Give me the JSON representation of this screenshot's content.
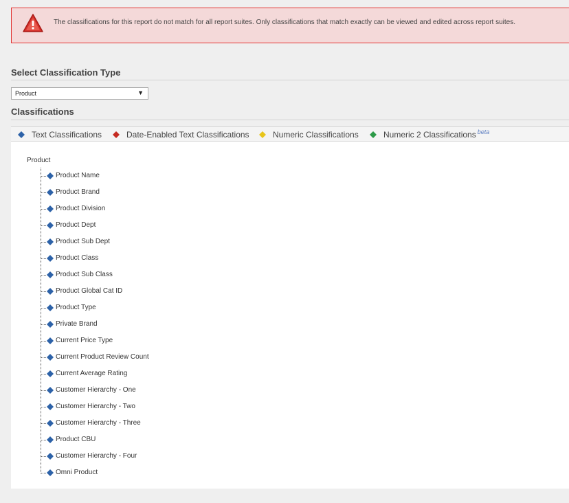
{
  "alert": {
    "message": "The classifications for this report do not match for all report suites. Only classifications that match exactly can be viewed and edited across report suites.",
    "color": "#e2302f"
  },
  "select_section": {
    "title": "Select Classification Type",
    "selected": "Product",
    "arrow": "▼"
  },
  "classifications_section": {
    "title": "Classifications"
  },
  "legend": [
    {
      "label": "Text Classifications",
      "icon": "blue-diamond-icon",
      "color": "#2d62a8"
    },
    {
      "label": "Date-Enabled Text Classifications",
      "icon": "red-diamond-icon",
      "color": "#c52b22"
    },
    {
      "label": "Numeric Classifications",
      "icon": "yellow-diamond-icon",
      "color": "#e8c51a"
    },
    {
      "label": "Numeric 2 Classifications",
      "icon": "green-diamond-icon",
      "color": "#2c9a48",
      "badge": "beta"
    }
  ],
  "tree": {
    "root": "Product",
    "items": [
      "Product Name",
      "Product Brand",
      "Product Division",
      "Product Dept",
      "Product Sub Dept",
      "Product Class",
      "Product Sub Class",
      "Product Global Cat ID",
      "Product Type",
      "Private Brand",
      "Current Price Type",
      "Current Product Review Count",
      "Current Average Rating",
      "Customer Hierarchy - One",
      "Customer Hierarchy - Two",
      "Customer Hierarchy - Three",
      "Product CBU",
      "Customer Hierarchy - Four",
      "Omni Product"
    ]
  }
}
